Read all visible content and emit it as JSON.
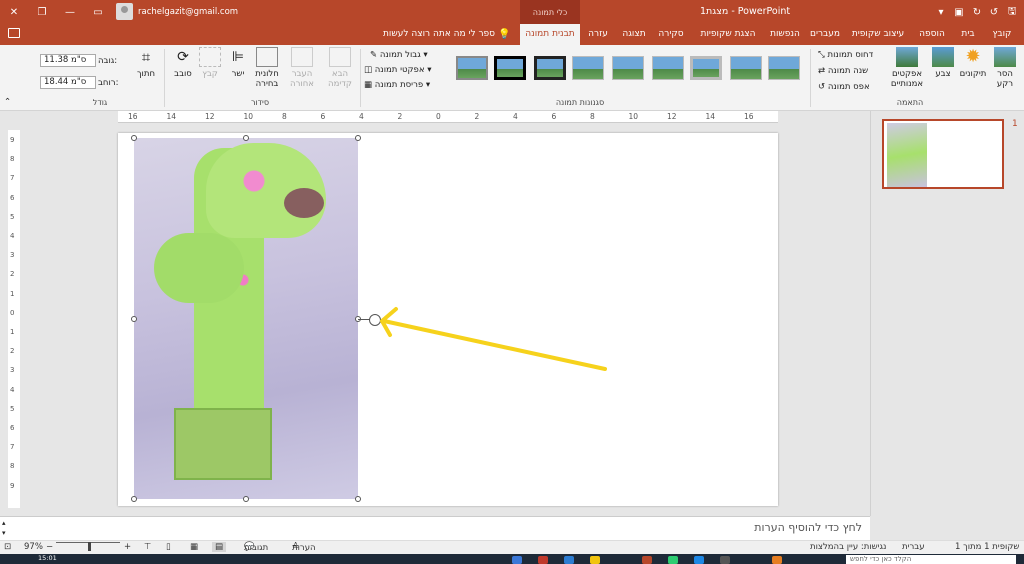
{
  "titlebar": {
    "doc_title": "מצגת1 - PowerPoint",
    "context_group": "כלי תמונה",
    "account_email": "rachelgazit@gmail.com"
  },
  "tabs": [
    {
      "label": "קובץ"
    },
    {
      "label": "בית"
    },
    {
      "label": "הוספה"
    },
    {
      "label": "עיצוב שקופית"
    },
    {
      "label": "מעברים"
    },
    {
      "label": "הנפשות"
    },
    {
      "label": "הצגת שקופיות"
    },
    {
      "label": "סקירה"
    },
    {
      "label": "תצוגה"
    },
    {
      "label": "עזרה"
    },
    {
      "label": "תבנית תמונה",
      "active": true
    }
  ],
  "tell_me": "ספר לי מה אתה רוצה לעשות",
  "ribbon": {
    "adjust": {
      "label": "התאמה",
      "remove_bg": "הסר רקע",
      "corrections": "תיקונים",
      "color": "צבע",
      "artistic": "אפקטים אמנותיים",
      "compress": "דחוס תמונות",
      "change": "שנה תמונה",
      "reset": "אפס תמונה"
    },
    "styles": {
      "label": "סגנונות תמונה",
      "border": "גבול תמונה",
      "effects": "אפקטי תמונה",
      "layout": "פריסת תמונה"
    },
    "arrange": {
      "label": "סידור",
      "bring_forward": "הבא קדימה",
      "send_backward": "העבר אחורה",
      "selection_pane": "חלונית בחירה",
      "align": "ישר",
      "group": "קבץ",
      "rotate": "סובב"
    },
    "size": {
      "label": "גודל",
      "crop": "חתוך",
      "height_label": "גובה:",
      "height_value": "11.38 ס\"מ",
      "width_label": "רוחב:",
      "width_value": "18.44 ס\"מ"
    }
  },
  "ruler_h": [
    "16",
    "14",
    "12",
    "10",
    "8",
    "6",
    "4",
    "2",
    "0",
    "2",
    "4",
    "6",
    "8",
    "10",
    "12",
    "14",
    "16"
  ],
  "ruler_v": [
    "9",
    "8",
    "7",
    "6",
    "5",
    "4",
    "3",
    "2",
    "1",
    "0",
    "1",
    "2",
    "3",
    "4",
    "5",
    "6",
    "7",
    "8",
    "9"
  ],
  "thumbnail_number": "1",
  "notes_placeholder": "לחץ כדי להוסיף הערות",
  "statusbar": {
    "slide_info": "שקופית 1 מתוך 1",
    "language": "עברית",
    "accessibility": "נגישות: עיין בהמלצות",
    "notes": "הערות",
    "comments": "תגובות",
    "zoom": "97%"
  },
  "taskbar": {
    "search_placeholder": "הקלד כאן כדי לחפש",
    "time": "15:01"
  },
  "colors": {
    "accent": "#b7472a",
    "arrow": "#f6d21c"
  }
}
